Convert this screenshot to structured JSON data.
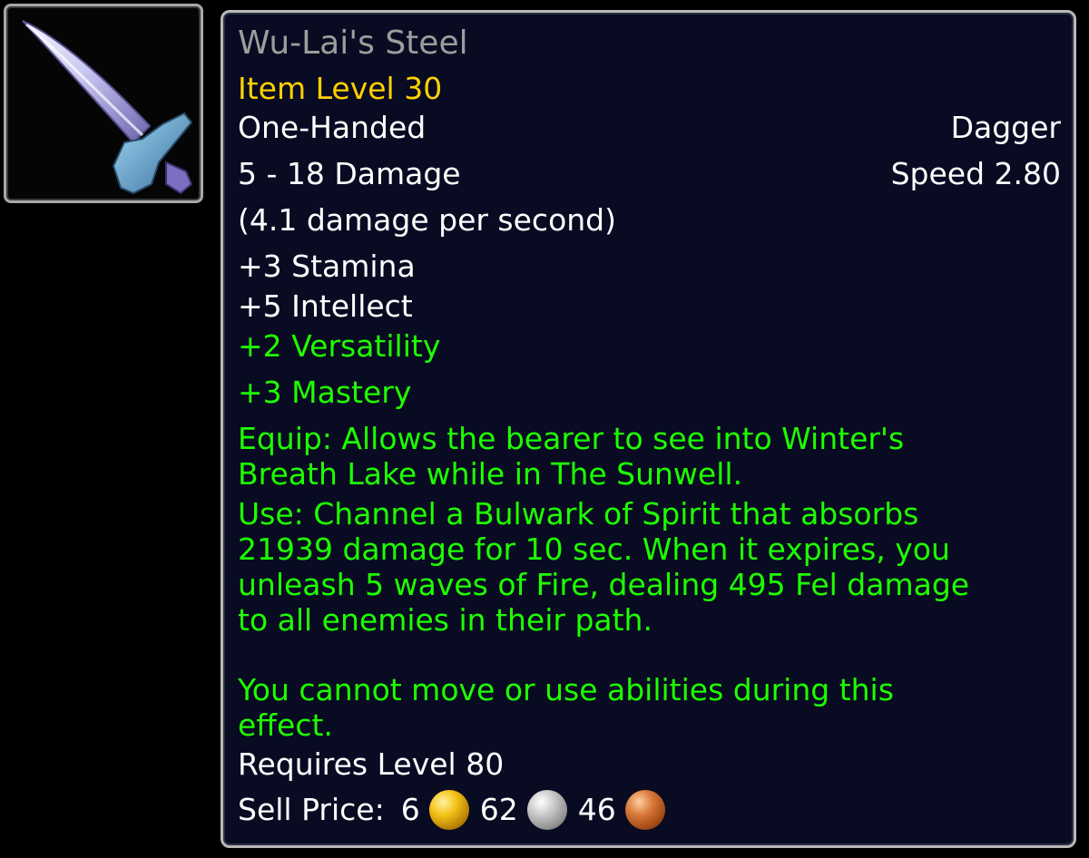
{
  "item": {
    "name": "Wu-Lai's Steel",
    "item_level": "Item Level 30",
    "slot": "One-Handed",
    "weapon_type": "Dagger",
    "damage": "5 - 18 Damage",
    "speed": "Speed 2.80",
    "dps": "(4.1 damage per second)",
    "stats": {
      "stamina": "+3 Stamina",
      "intellect": "+5 Intellect",
      "versatility": "+2 Versatility",
      "mastery": "+3 Mastery"
    },
    "equip_effect_lines": [
      "Equip: Allows the bearer to see into Winter's",
      "Breath Lake while in The Sunwell."
    ],
    "use_effect_lines": [
      "Use: Channel a Bulwark of Spirit that absorbs",
      "21939 damage for 10 sec. When it expires, you",
      "unleash 5 waves of Fire, dealing 495 Fel damage",
      "to all enemies in their path."
    ],
    "use_note_lines": [
      "You cannot move or use abilities during this",
      "effect."
    ],
    "requires": "Requires Level 80",
    "sell_price": {
      "label": "Sell Price:",
      "gold": "6",
      "silver": "62",
      "copper": "46"
    }
  },
  "icon": {
    "name": "dagger-icon"
  },
  "colors": {
    "title_poor_gray": "#9d9d9d",
    "item_level_gold": "#ffd100",
    "bonus_green": "#1eff00",
    "tooltip_bg": "#080b22"
  }
}
